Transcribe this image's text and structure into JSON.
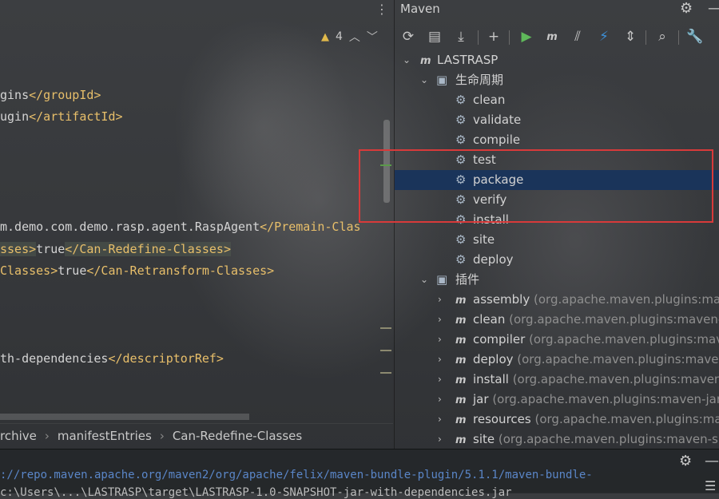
{
  "editor": {
    "warning_count": "4",
    "code_lines": [
      {
        "pre": "gins",
        "tag": "</groupId>",
        "post": ""
      },
      {
        "pre": "ugin",
        "tag": "</artifactId>",
        "post": ""
      },
      {
        "pre": "m.demo.com.demo.rasp.agent.RaspAgent",
        "tag": "</Premain-Clas",
        "post": ""
      },
      {
        "pre": "sses",
        "tag": ">",
        "mid": "true",
        "tag2": "</Can-Redefine-Classes>"
      },
      {
        "pre": "Classes",
        "tag": ">",
        "mid": "true",
        "tag2": "</Can-Retransform-Classes>"
      },
      {
        "pre": "th-dependencies",
        "tag": "</descriptorRef>",
        "post": ""
      }
    ],
    "breadcrumb": [
      "rchive",
      "manifestEntries",
      "Can-Redefine-Classes"
    ]
  },
  "maven": {
    "title": "Maven",
    "project": "LASTRASP",
    "lifecycle_label": "生命周期",
    "lifecycle": [
      "clean",
      "validate",
      "compile",
      "test",
      "package",
      "verify",
      "install",
      "site",
      "deploy"
    ],
    "selected": "package",
    "plugins_label": "插件",
    "plugins": [
      {
        "name": "assembly",
        "coord": "(org.apache.maven.plugins:mave"
      },
      {
        "name": "clean",
        "coord": "(org.apache.maven.plugins:maven-cl"
      },
      {
        "name": "compiler",
        "coord": "(org.apache.maven.plugins:mave"
      },
      {
        "name": "deploy",
        "coord": "(org.apache.maven.plugins:maven"
      },
      {
        "name": "install",
        "coord": "(org.apache.maven.plugins:maven-in"
      },
      {
        "name": "jar",
        "coord": "(org.apache.maven.plugins:maven-jar-p"
      },
      {
        "name": "resources",
        "coord": "(org.apache.maven.plugins:mave"
      },
      {
        "name": "site",
        "coord": "(org.apache.maven.plugins:maven-site"
      }
    ]
  },
  "bottom": {
    "log1": "://repo.maven.apache.org/maven2/org/apache/felix/maven-bundle-plugin/5.1.1/maven-bundle-",
    "log2": "c:\\Users\\...\\LASTRASP\\target\\LASTRASP-1.0-SNAPSHOT-jar-with-dependencies.jar"
  }
}
